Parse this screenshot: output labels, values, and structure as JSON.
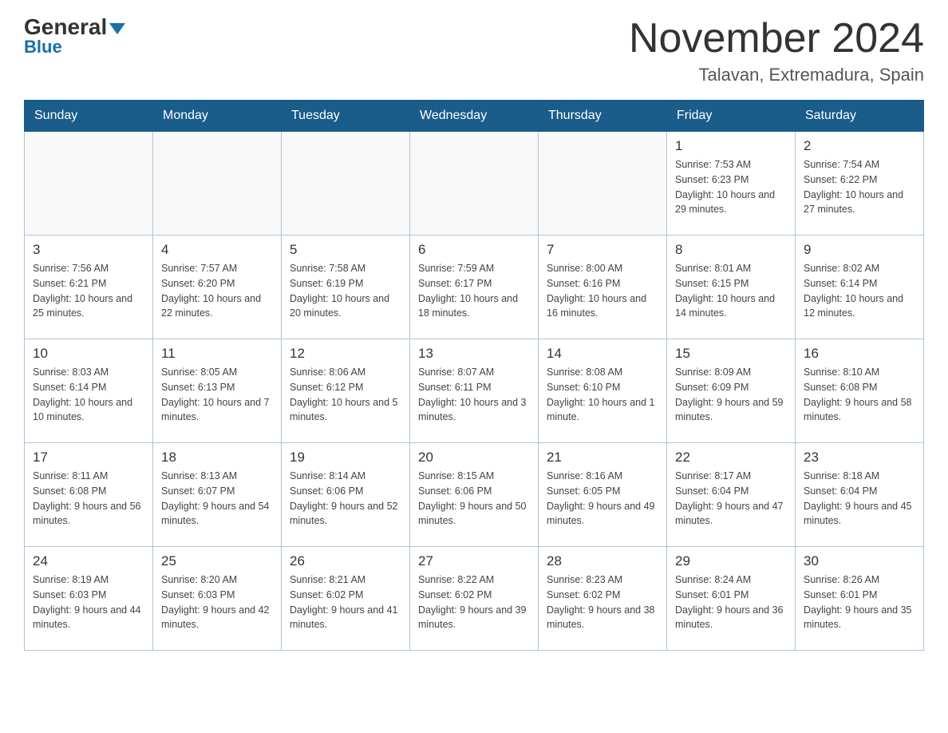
{
  "header": {
    "logo_general": "General",
    "logo_blue": "Blue",
    "title": "November 2024",
    "location": "Talavan, Extremadura, Spain"
  },
  "days_of_week": [
    "Sunday",
    "Monday",
    "Tuesday",
    "Wednesday",
    "Thursday",
    "Friday",
    "Saturday"
  ],
  "weeks": [
    [
      {
        "day": "",
        "info": ""
      },
      {
        "day": "",
        "info": ""
      },
      {
        "day": "",
        "info": ""
      },
      {
        "day": "",
        "info": ""
      },
      {
        "day": "",
        "info": ""
      },
      {
        "day": "1",
        "info": "Sunrise: 7:53 AM\nSunset: 6:23 PM\nDaylight: 10 hours and 29 minutes."
      },
      {
        "day": "2",
        "info": "Sunrise: 7:54 AM\nSunset: 6:22 PM\nDaylight: 10 hours and 27 minutes."
      }
    ],
    [
      {
        "day": "3",
        "info": "Sunrise: 7:56 AM\nSunset: 6:21 PM\nDaylight: 10 hours and 25 minutes."
      },
      {
        "day": "4",
        "info": "Sunrise: 7:57 AM\nSunset: 6:20 PM\nDaylight: 10 hours and 22 minutes."
      },
      {
        "day": "5",
        "info": "Sunrise: 7:58 AM\nSunset: 6:19 PM\nDaylight: 10 hours and 20 minutes."
      },
      {
        "day": "6",
        "info": "Sunrise: 7:59 AM\nSunset: 6:17 PM\nDaylight: 10 hours and 18 minutes."
      },
      {
        "day": "7",
        "info": "Sunrise: 8:00 AM\nSunset: 6:16 PM\nDaylight: 10 hours and 16 minutes."
      },
      {
        "day": "8",
        "info": "Sunrise: 8:01 AM\nSunset: 6:15 PM\nDaylight: 10 hours and 14 minutes."
      },
      {
        "day": "9",
        "info": "Sunrise: 8:02 AM\nSunset: 6:14 PM\nDaylight: 10 hours and 12 minutes."
      }
    ],
    [
      {
        "day": "10",
        "info": "Sunrise: 8:03 AM\nSunset: 6:14 PM\nDaylight: 10 hours and 10 minutes."
      },
      {
        "day": "11",
        "info": "Sunrise: 8:05 AM\nSunset: 6:13 PM\nDaylight: 10 hours and 7 minutes."
      },
      {
        "day": "12",
        "info": "Sunrise: 8:06 AM\nSunset: 6:12 PM\nDaylight: 10 hours and 5 minutes."
      },
      {
        "day": "13",
        "info": "Sunrise: 8:07 AM\nSunset: 6:11 PM\nDaylight: 10 hours and 3 minutes."
      },
      {
        "day": "14",
        "info": "Sunrise: 8:08 AM\nSunset: 6:10 PM\nDaylight: 10 hours and 1 minute."
      },
      {
        "day": "15",
        "info": "Sunrise: 8:09 AM\nSunset: 6:09 PM\nDaylight: 9 hours and 59 minutes."
      },
      {
        "day": "16",
        "info": "Sunrise: 8:10 AM\nSunset: 6:08 PM\nDaylight: 9 hours and 58 minutes."
      }
    ],
    [
      {
        "day": "17",
        "info": "Sunrise: 8:11 AM\nSunset: 6:08 PM\nDaylight: 9 hours and 56 minutes."
      },
      {
        "day": "18",
        "info": "Sunrise: 8:13 AM\nSunset: 6:07 PM\nDaylight: 9 hours and 54 minutes."
      },
      {
        "day": "19",
        "info": "Sunrise: 8:14 AM\nSunset: 6:06 PM\nDaylight: 9 hours and 52 minutes."
      },
      {
        "day": "20",
        "info": "Sunrise: 8:15 AM\nSunset: 6:06 PM\nDaylight: 9 hours and 50 minutes."
      },
      {
        "day": "21",
        "info": "Sunrise: 8:16 AM\nSunset: 6:05 PM\nDaylight: 9 hours and 49 minutes."
      },
      {
        "day": "22",
        "info": "Sunrise: 8:17 AM\nSunset: 6:04 PM\nDaylight: 9 hours and 47 minutes."
      },
      {
        "day": "23",
        "info": "Sunrise: 8:18 AM\nSunset: 6:04 PM\nDaylight: 9 hours and 45 minutes."
      }
    ],
    [
      {
        "day": "24",
        "info": "Sunrise: 8:19 AM\nSunset: 6:03 PM\nDaylight: 9 hours and 44 minutes."
      },
      {
        "day": "25",
        "info": "Sunrise: 8:20 AM\nSunset: 6:03 PM\nDaylight: 9 hours and 42 minutes."
      },
      {
        "day": "26",
        "info": "Sunrise: 8:21 AM\nSunset: 6:02 PM\nDaylight: 9 hours and 41 minutes."
      },
      {
        "day": "27",
        "info": "Sunrise: 8:22 AM\nSunset: 6:02 PM\nDaylight: 9 hours and 39 minutes."
      },
      {
        "day": "28",
        "info": "Sunrise: 8:23 AM\nSunset: 6:02 PM\nDaylight: 9 hours and 38 minutes."
      },
      {
        "day": "29",
        "info": "Sunrise: 8:24 AM\nSunset: 6:01 PM\nDaylight: 9 hours and 36 minutes."
      },
      {
        "day": "30",
        "info": "Sunrise: 8:26 AM\nSunset: 6:01 PM\nDaylight: 9 hours and 35 minutes."
      }
    ]
  ]
}
